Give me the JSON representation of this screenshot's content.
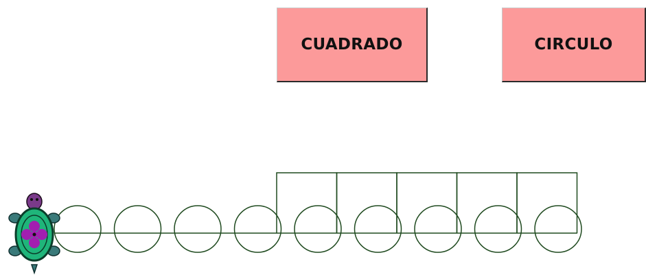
{
  "buttons": {
    "square": {
      "label": "CUADRADO",
      "color": "#fc9a9a"
    },
    "circle": {
      "label": "CIRCULO",
      "color": "#fc9a9a"
    }
  },
  "drawing": {
    "stroke_color": "#1f4a1f",
    "circles_drawn": 9,
    "squares_drawn": 5
  },
  "turtle": {
    "icon": "turtle-icon",
    "heading": "up",
    "shell_color": "#1fb57a",
    "flower_color": "#a21fb0"
  }
}
